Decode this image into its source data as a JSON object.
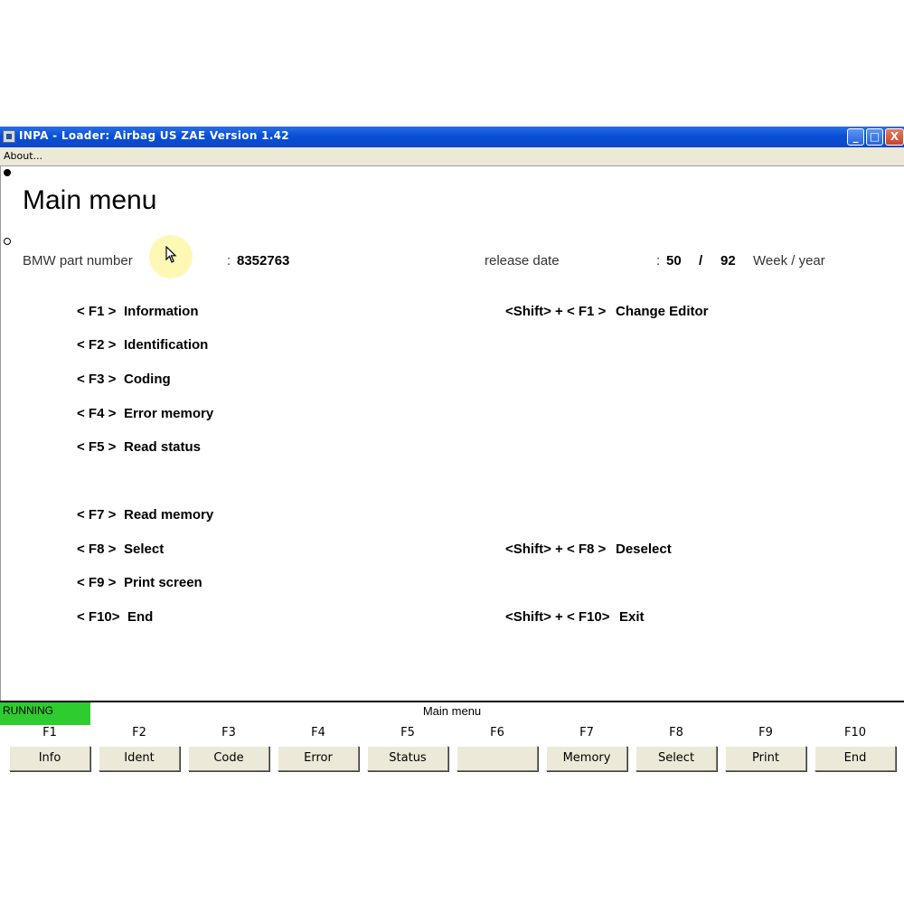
{
  "window": {
    "title": "INPA - Loader:  Airbag US ZAE Version 1.42",
    "controls": {
      "minimize": "_",
      "maximize": "□",
      "close": "X"
    }
  },
  "menubar": {
    "about": "About..."
  },
  "page": {
    "title": "Main menu",
    "part_label": "BMW part number",
    "part_colon": ":",
    "part_value": "8352763",
    "release_label": "release date",
    "release_colon": ":",
    "release_week": "50",
    "release_sep": "/",
    "release_year": "92",
    "release_unit": "Week / year"
  },
  "keys_left": [
    {
      "key": "< F1 >",
      "desc": "Information"
    },
    {
      "key": "< F2 >",
      "desc": "Identification"
    },
    {
      "key": "< F3 >",
      "desc": "Coding"
    },
    {
      "key": "< F4 >",
      "desc": "Error memory"
    },
    {
      "key": "< F5 >",
      "desc": "Read status"
    },
    {
      "key": "< F7 >",
      "desc": "Read memory"
    },
    {
      "key": "< F8 >",
      "desc": "Select"
    },
    {
      "key": "< F9 >",
      "desc": "Print screen"
    },
    {
      "key": "< F10>",
      "desc": "End"
    }
  ],
  "keys_right": [
    {
      "key": "<Shift> + < F1 >",
      "desc": "Change Editor"
    },
    {
      "key": "<Shift> + < F8 >",
      "desc": "Deselect"
    },
    {
      "key": "<Shift> + < F10>",
      "desc": "Exit"
    }
  ],
  "status": {
    "running": "RUNNING",
    "title": "Main menu",
    "running_color": "#2ecc2e"
  },
  "fkeys": [
    {
      "label": "F1",
      "button": "Info"
    },
    {
      "label": "F2",
      "button": "Ident"
    },
    {
      "label": "F3",
      "button": "Code"
    },
    {
      "label": "F4",
      "button": "Error"
    },
    {
      "label": "F5",
      "button": "Status"
    },
    {
      "label": "F6",
      "button": ""
    },
    {
      "label": "F7",
      "button": "Memory"
    },
    {
      "label": "F8",
      "button": "Select"
    },
    {
      "label": "F9",
      "button": "Print"
    },
    {
      "label": "F10",
      "button": "End"
    }
  ]
}
